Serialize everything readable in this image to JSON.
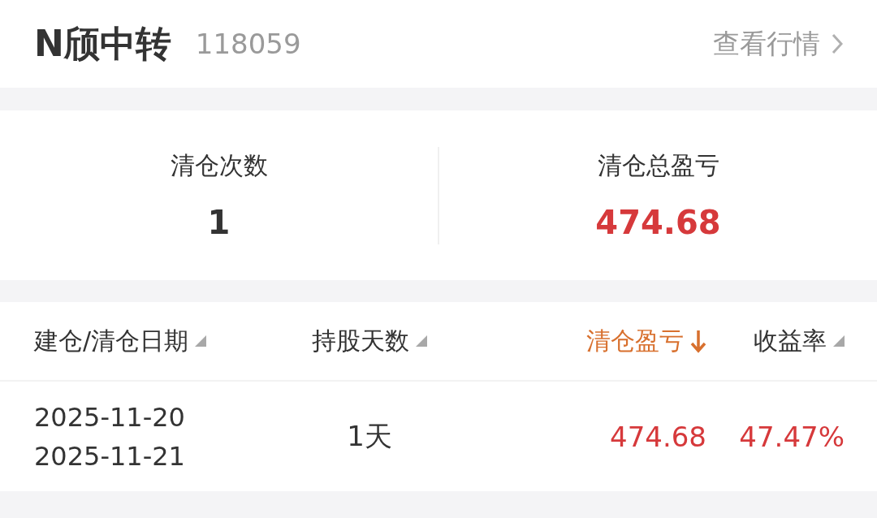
{
  "header": {
    "name": "N颀中转",
    "code": "118059",
    "link": "查看行情"
  },
  "stats": [
    {
      "label": "清仓次数",
      "value": "1",
      "color": "#333333"
    },
    {
      "label": "清仓总盈亏",
      "value": "474.68",
      "color": "#d6393b"
    }
  ],
  "table": {
    "columns": [
      {
        "label": "建仓/清仓日期",
        "selected": false
      },
      {
        "label": "持股天数",
        "selected": false
      },
      {
        "label": "清仓盈亏",
        "selected": true
      },
      {
        "label": "收益率",
        "selected": false
      }
    ],
    "rows": [
      {
        "dates": [
          "2025-11-20",
          "2025-11-21"
        ],
        "days": "1天",
        "profit": "474.68",
        "rate": "47.47%",
        "color": "#d6393b"
      }
    ]
  }
}
